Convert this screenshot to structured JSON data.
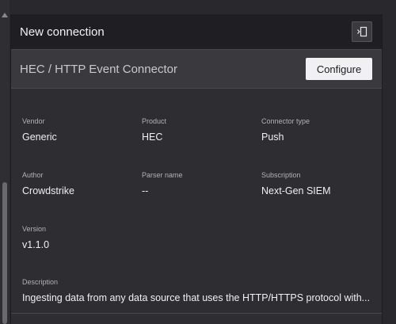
{
  "panel": {
    "title": "New connection",
    "collapse_icon": "panel-collapse-icon"
  },
  "connector": {
    "name": "HEC / HTTP Event Connector",
    "configure_label": "Configure"
  },
  "details": {
    "vendor": {
      "label": "Vendor",
      "value": "Generic"
    },
    "product": {
      "label": "Product",
      "value": "HEC"
    },
    "connector_type": {
      "label": "Connector type",
      "value": "Push"
    },
    "author": {
      "label": "Author",
      "value": "Crowdstrike"
    },
    "parser_name": {
      "label": "Parser name",
      "value": "--"
    },
    "subscription": {
      "label": "Subscription",
      "value": "Next-Gen SIEM"
    },
    "version": {
      "label": "Version",
      "value": "v1.1.0"
    },
    "description": {
      "label": "Description",
      "value": "Ingesting data from any data source that uses the HTTP/HTTPS protocol with..."
    }
  },
  "colors": {
    "background": "#29282c",
    "header": "#1f1e22",
    "subheader": "#3a393e",
    "button": "#f1f1f4"
  }
}
